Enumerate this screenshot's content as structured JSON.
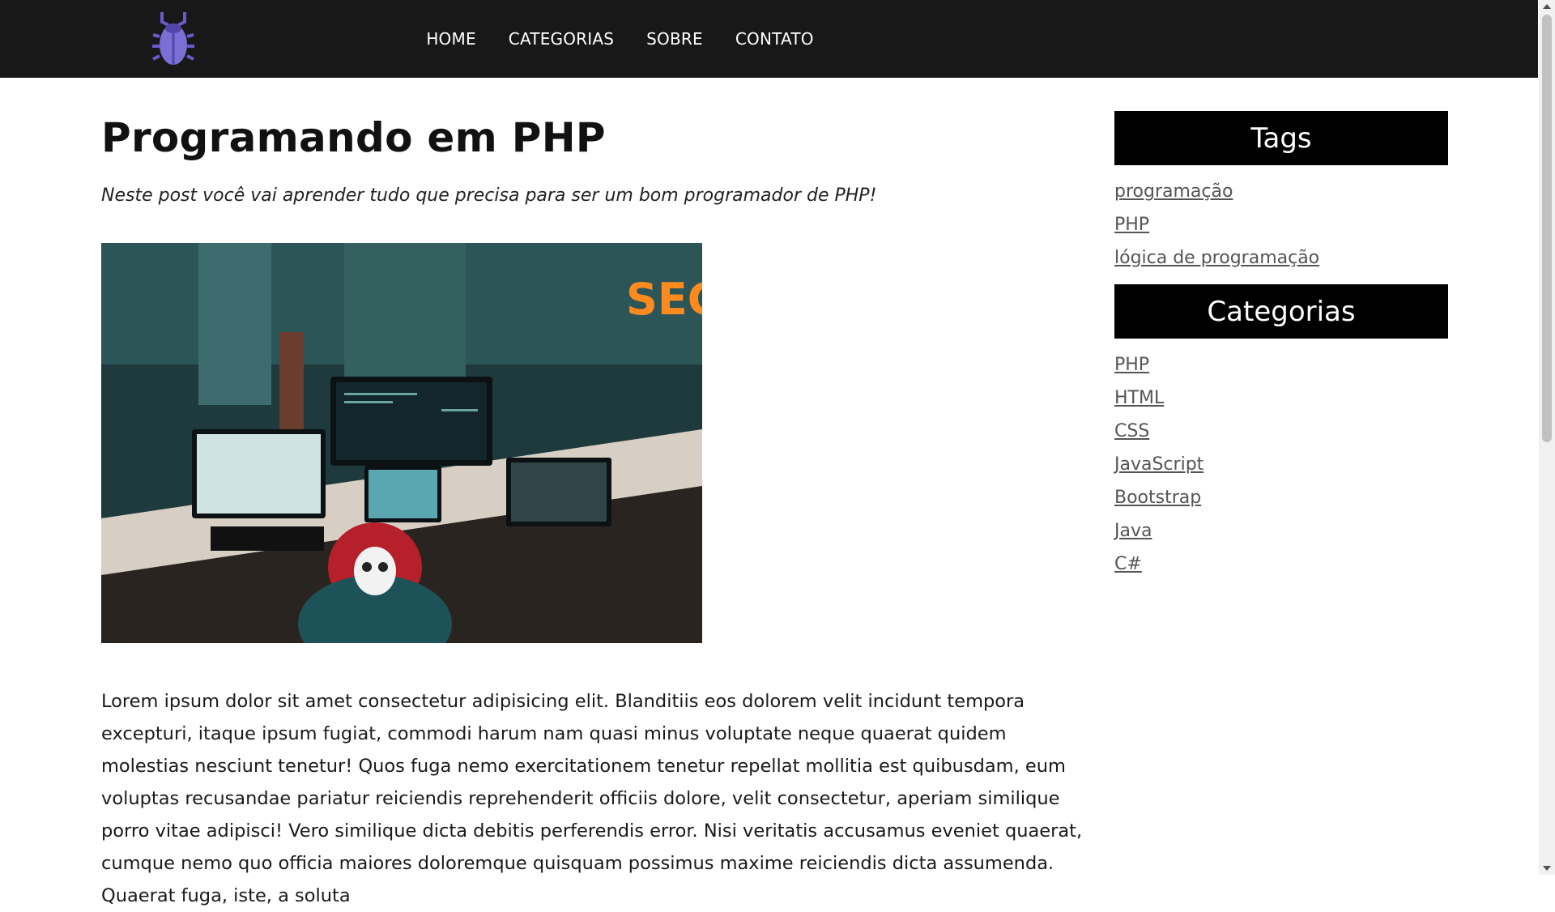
{
  "nav": {
    "logo": "bug-logo",
    "links": [
      "HOME",
      "CATEGORIAS",
      "SOBRE",
      "CONTATO"
    ]
  },
  "post": {
    "title": "Programando em PHP",
    "subtitle": "Neste post você vai aprender tudo que precisa para ser um bom programador de PHP!",
    "body": "Lorem ipsum dolor sit amet consectetur adipisicing elit. Blanditiis eos dolorem velit incidunt tempora excepturi, itaque ipsum fugiat, commodi harum nam quasi minus voluptate neque quaerat quidem molestias nesciunt tenetur! Quos fuga nemo exercitationem tenetur repellat mollitia est quibusdam, eum voluptas recusandae pariatur reiciendis reprehenderit officiis dolore, velit consectetur, aperiam similique porro vitae adipisci! Vero similique dicta debitis perferendis error. Nisi veritatis accusamus eveniet quaerat, cumque nemo quo officia maiores doloremque quisquam possimus maxime reiciendis dicta assumenda. Quaerat fuga, iste, a soluta"
  },
  "sidebar": {
    "tags_title": "Tags",
    "tags": [
      "programação",
      "PHP",
      "lógica de programação"
    ],
    "categories_title": "Categorias",
    "categories": [
      "PHP",
      "HTML",
      "CSS",
      "JavaScript",
      "Bootstrap",
      "Java",
      "C#"
    ]
  },
  "colors": {
    "navbar": "#181818",
    "sidebar_header": "#000000",
    "logo_purple": "#6a5acd",
    "link_gray": "#555555"
  }
}
